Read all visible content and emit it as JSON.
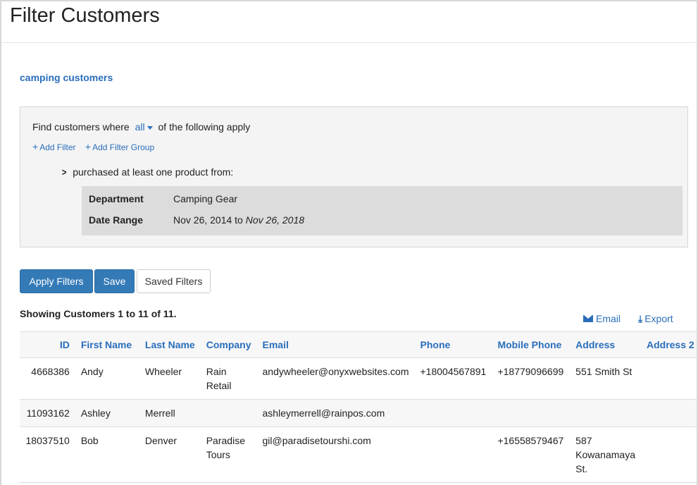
{
  "page": {
    "title": "Filter Customers"
  },
  "filter": {
    "name": "camping customers",
    "find_prefix": "Find customers where",
    "match_mode": "all",
    "find_suffix": "of the following apply",
    "add_filter": "Add Filter",
    "add_filter_group": "Add Filter Group",
    "condition": "purchased at least one product from:",
    "fields": {
      "department_label": "Department",
      "department_value": "Camping Gear",
      "date_label": "Date Range",
      "date_from": "Nov 26, 2014 to",
      "date_to": "Nov 26, 2018"
    }
  },
  "buttons": {
    "apply": "Apply Filters",
    "save": "Save",
    "saved_filters": "Saved Filters"
  },
  "results": {
    "showing": "Showing Customers 1 to 11 of 11.",
    "email_action": "Email",
    "export_action": "Export"
  },
  "table": {
    "columns": [
      "ID",
      "First Name",
      "Last Name",
      "Company",
      "Email",
      "Phone",
      "Mobile Phone",
      "Address",
      "Address 2"
    ],
    "rows": [
      {
        "id": "4668386",
        "first": "Andy",
        "last": "Wheeler",
        "company_l1": "Rain",
        "company_l2": "Retail",
        "email": "andywheeler@onyxwebsites.com",
        "phone": "+18004567891",
        "mobile": "+18779096699",
        "addr_l1": "551 Smith St",
        "addr_l2": "",
        "addr_l3": "",
        "address2": ""
      },
      {
        "id": "11093162",
        "first": "Ashley",
        "last": "Merrell",
        "company_l1": "",
        "company_l2": "",
        "email": "ashleymerrell@rainpos.com",
        "phone": "",
        "mobile": "",
        "addr_l1": "",
        "addr_l2": "",
        "addr_l3": "",
        "address2": ""
      },
      {
        "id": "18037510",
        "first": "Bob",
        "last": "Denver",
        "company_l1": "Paradise",
        "company_l2": "Tours",
        "email": "gil@paradisetourshi.com",
        "phone": "",
        "mobile": "+16558579467",
        "addr_l1": "587",
        "addr_l2": "Kowanamaya",
        "addr_l3": "St.",
        "address2": ""
      }
    ]
  },
  "colors": {
    "link": "#2a6ebb",
    "primary_button": "#337ab7",
    "panel_bg": "#f4f4f4",
    "condition_bg": "#dcdcdc"
  }
}
